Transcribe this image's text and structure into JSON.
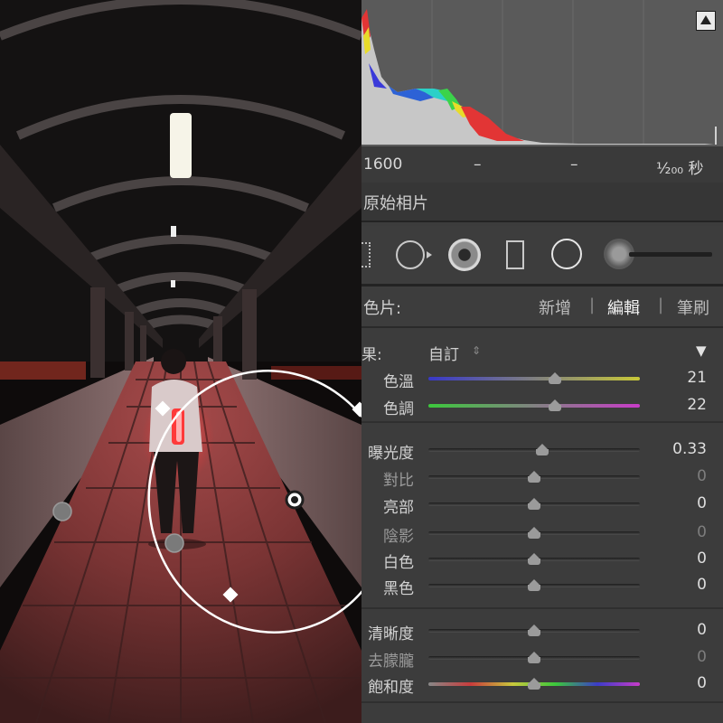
{
  "canvas": {
    "description_icon": "photo-being-edited"
  },
  "histogram": {
    "toggle_icon": "triangle-up-icon"
  },
  "exif": {
    "iso": "1600",
    "focal": "–",
    "aperture": "–",
    "shutter": "¹⁄₂₀₀ 秒"
  },
  "original_photo_label": "原始相片",
  "tools": {
    "items": [
      "crop-icon",
      "spot-removal-icon",
      "red-eye-icon",
      "graduated-filter-icon",
      "radial-filter-icon",
      "adjustment-brush-icon"
    ]
  },
  "mask": {
    "label": "色片:",
    "new_label": "新增",
    "edit_label": "編輯",
    "brush_label": "筆刷",
    "divider": "|"
  },
  "effect": {
    "label": "果:",
    "value": "自訂",
    "arrow": "▼"
  },
  "sliders": [
    {
      "label": "色溫",
      "value": "21",
      "pos": 0.6,
      "track": "temp",
      "dim": false
    },
    {
      "label": "色調",
      "value": "22",
      "pos": 0.6,
      "track": "tint",
      "dim": false
    },
    {
      "label": "曝光度",
      "value": "0.33",
      "pos": 0.54,
      "track": "dark",
      "dim": false
    },
    {
      "label": "對比",
      "value": "0",
      "pos": 0.5,
      "track": "dark",
      "dim": true
    },
    {
      "label": "亮部",
      "value": "0",
      "pos": 0.5,
      "track": "dark",
      "dim": false
    },
    {
      "label": "陰影",
      "value": "0",
      "pos": 0.5,
      "track": "dark",
      "dim": true
    },
    {
      "label": "白色",
      "value": "0",
      "pos": 0.5,
      "track": "dark",
      "dim": false
    },
    {
      "label": "黑色",
      "value": "0",
      "pos": 0.5,
      "track": "dark",
      "dim": false
    },
    {
      "label": "清晰度",
      "value": "0",
      "pos": 0.5,
      "track": "dark",
      "dim": false
    },
    {
      "label": "去朦朧",
      "value": "0",
      "pos": 0.5,
      "track": "dark",
      "dim": true
    },
    {
      "label": "飽和度",
      "value": "0",
      "pos": 0.5,
      "track": "sat",
      "dim": false
    }
  ],
  "colors": {
    "panel_bg": "#3c3c3c",
    "histogram_bg": "#5a5a5a",
    "overlay_line": "#ffffff",
    "tile_tint": "#c25a5a"
  }
}
